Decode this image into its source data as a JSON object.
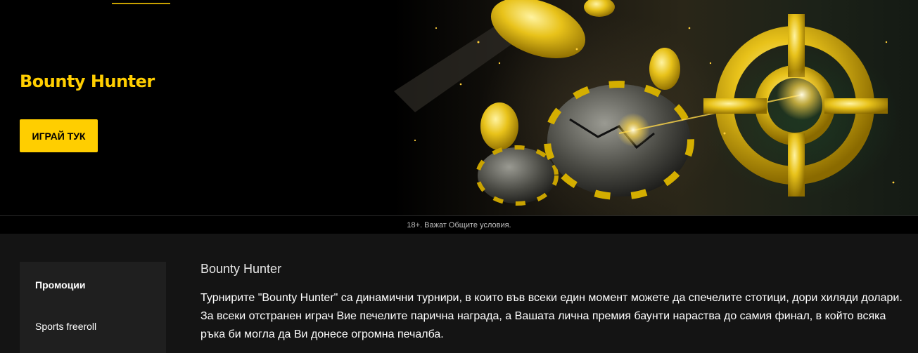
{
  "hero": {
    "title": "Bounty Hunter",
    "cta_label": "ИГРАЙ ТУК",
    "accent_color": "#ffce00"
  },
  "disclaimer": {
    "text": "18+. Важат Общите условия."
  },
  "sidebar": {
    "items": [
      {
        "label": "Промоции",
        "active": true
      },
      {
        "label": "Sports freeroll",
        "active": false
      }
    ]
  },
  "main": {
    "title": "Bounty Hunter",
    "text": "Турнирите \"Bounty Hunter\" са динамични турнири, в които във всеки един момент можете да спечелите стотици, дори хиляди долари. За всеки отстранен играч Вие печелите парична награда, а Вашата лична премия баунти нараства до самия финал, в който всяка ръка би могла да Ви донесе огромна печалба."
  }
}
